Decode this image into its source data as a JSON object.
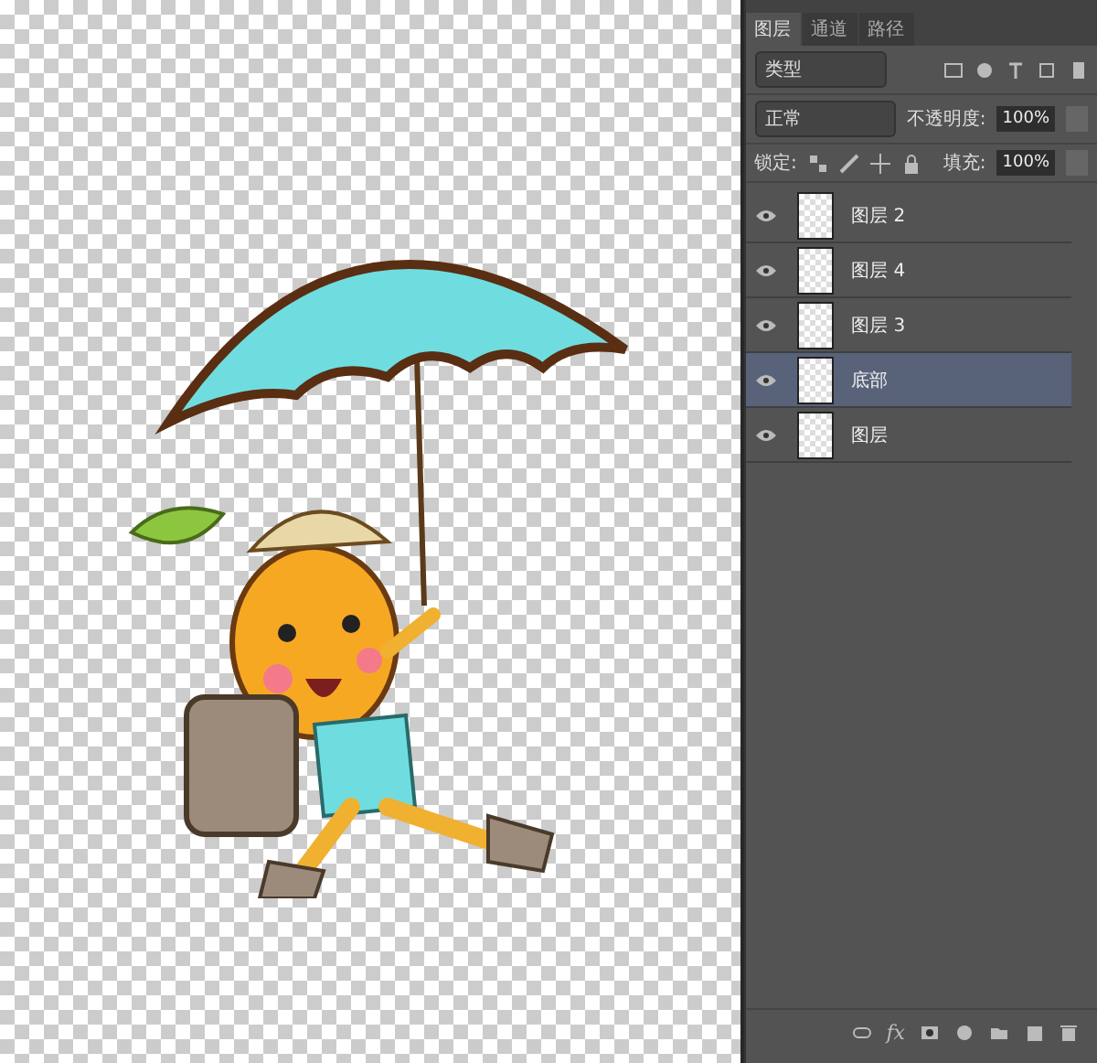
{
  "tabs": [
    {
      "label": "图层",
      "selected": true
    },
    {
      "label": "通道",
      "selected": false
    },
    {
      "label": "路径",
      "selected": false
    }
  ],
  "filter": {
    "value": "类型"
  },
  "blend_mode": {
    "value": "正常"
  },
  "opacity": {
    "label": "不透明度:",
    "value": "100%"
  },
  "lock": {
    "label": "锁定:"
  },
  "fill": {
    "label": "填充:",
    "value": "100%"
  },
  "layers": [
    {
      "name": "图层 2",
      "visible": true,
      "selected": false
    },
    {
      "name": "图层 4",
      "visible": true,
      "selected": false
    },
    {
      "name": "图层 3",
      "visible": true,
      "selected": false
    },
    {
      "name": "底部",
      "visible": true,
      "selected": true
    },
    {
      "name": "图层",
      "visible": true,
      "selected": false
    }
  ],
  "toolbar": {
    "fx_label": "fx"
  }
}
